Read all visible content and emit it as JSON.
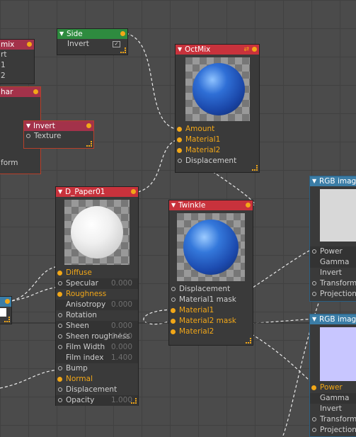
{
  "nodes": {
    "mix_left": {
      "title": "mix",
      "rows": [
        "rt",
        "1",
        "2"
      ]
    },
    "char_left": {
      "title": "har",
      "rows": [
        "form"
      ]
    },
    "invert": {
      "title": "Invert",
      "rows": [
        "Texture"
      ]
    },
    "side": {
      "title": "Side",
      "rows": [
        "Invert"
      ]
    },
    "octmix": {
      "title": "OctMix",
      "rows": [
        "Amount",
        "Material1",
        "Material2",
        "Displacement"
      ]
    },
    "dpaper": {
      "title": "D_Paper01",
      "rows": [
        {
          "label": "Diffuse",
          "value": ""
        },
        {
          "label": "Specular",
          "value": "0.000"
        },
        {
          "label": "Roughness",
          "value": ""
        },
        {
          "label": "Anisotropy",
          "value": "0.000"
        },
        {
          "label": "Rotation",
          "value": ""
        },
        {
          "label": "Sheen",
          "value": "0.000"
        },
        {
          "label": "Sheen roughness",
          "value": "0.100"
        },
        {
          "label": "Film Width",
          "value": "0.000"
        },
        {
          "label": "Film index",
          "value": "1.400"
        },
        {
          "label": "Bump",
          "value": ""
        },
        {
          "label": "Normal",
          "value": ""
        },
        {
          "label": "Displacement",
          "value": ""
        },
        {
          "label": "Opacity",
          "value": "1.000"
        }
      ]
    },
    "twinkle": {
      "title": "Twinkle",
      "rows": [
        "Displacement",
        "Material1 mask",
        "Material1",
        "Material2 mask",
        "Material2"
      ]
    },
    "rgb1": {
      "title": "RGB image",
      "rows": [
        "Power",
        "Gamma",
        "Invert",
        "Transform",
        "Projection"
      ]
    },
    "rgb2": {
      "title": "RGB image",
      "rows": [
        "Power",
        "Gamma",
        "Invert",
        "Transform",
        "Projection"
      ]
    }
  },
  "colors": {
    "accent": "#f2a718",
    "header_red": "#c8323c",
    "header_green": "#2e8b3f",
    "header_blue": "#3b7da6",
    "header_maroon": "#a3324a"
  }
}
